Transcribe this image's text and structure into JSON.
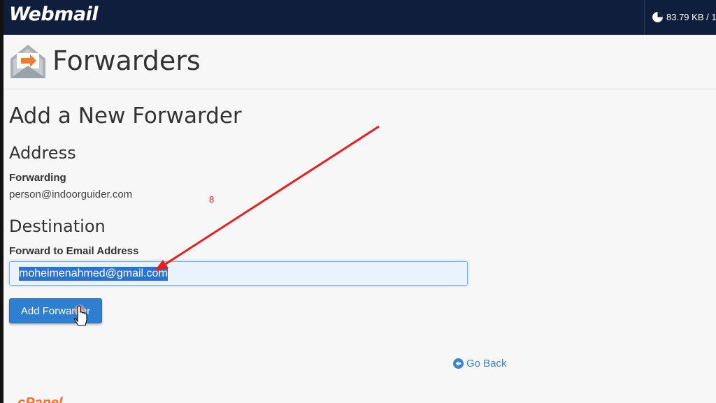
{
  "header": {
    "logo_text": "Webmail",
    "disk_usage": "83.79 KB / 1",
    "icons": {
      "disk": "pie-chart-icon"
    }
  },
  "page": {
    "title": "Forwarders",
    "icon": "email-forward-icon"
  },
  "form": {
    "section_title": "Add a New Forwarder",
    "address_heading": "Address",
    "forwarding_label": "Forwarding",
    "forwarding_value": "person@indoorguider.com",
    "step_annotation": "8",
    "destination_heading": "Destination",
    "forward_to_label": "Forward to Email Address",
    "forward_to_value": "moheimenahmed@gmail.com",
    "submit_label": "Add Forwarder"
  },
  "footer": {
    "go_back_label": "Go Back",
    "brand_text": "cPanel"
  },
  "colors": {
    "topbar": "#0f1e3c",
    "primary_button": "#2f7fd0",
    "link": "#3a86c8",
    "annotation": "#e02020",
    "brand_orange": "#ff6c2c"
  }
}
